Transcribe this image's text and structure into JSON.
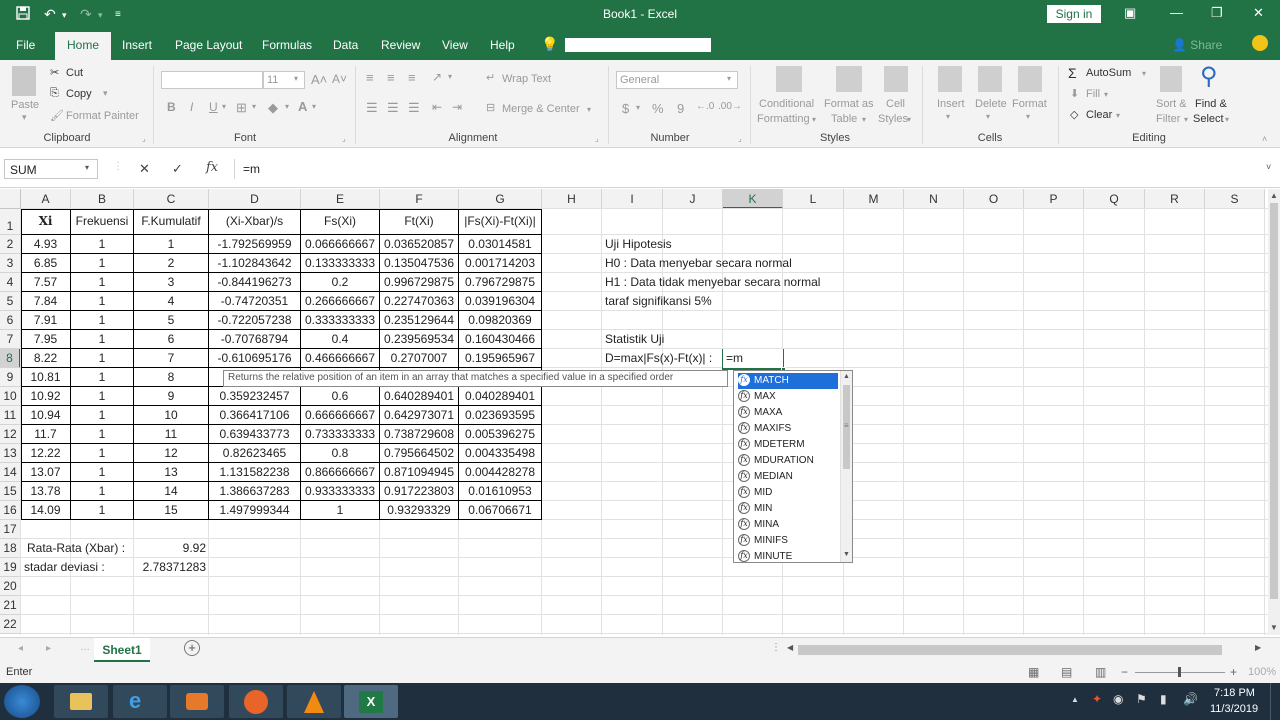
{
  "window": {
    "title": "Book1  -  Excel",
    "sign_in": "Sign in"
  },
  "ribbon_tabs": [
    "File",
    "Home",
    "Insert",
    "Page Layout",
    "Formulas",
    "Data",
    "Review",
    "View",
    "Help"
  ],
  "share_label": "Share",
  "ribbon": {
    "clipboard": {
      "paste": "Paste",
      "cut": "Cut",
      "copy": "Copy",
      "format_painter": "Format Painter",
      "group": "Clipboard"
    },
    "font": {
      "size": "11",
      "bold": "B",
      "italic": "I",
      "underline": "U",
      "group": "Font"
    },
    "alignment": {
      "wrap": "Wrap Text",
      "merge": "Merge & Center",
      "group": "Alignment"
    },
    "number": {
      "format": "General",
      "currency": "$",
      "percent": "%",
      "comma": "9",
      "group": "Number"
    },
    "styles": {
      "conditional": "Conditional",
      "conditional2": "Formatting",
      "format_as": "Format as",
      "format_as2": "Table",
      "cell": "Cell",
      "cell2": "Styles",
      "group": "Styles"
    },
    "cells": {
      "insert": "Insert",
      "delete": "Delete",
      "format": "Format",
      "group": "Cells"
    },
    "editing": {
      "autosum": "AutoSum",
      "fill": "Fill",
      "clear": "Clear",
      "sort": "Sort &",
      "sort2": "Filter",
      "find": "Find &",
      "find2": "Select",
      "group": "Editing"
    }
  },
  "formula_bar": {
    "name_box": "SUM",
    "cancel": "✕",
    "enter": "✓",
    "fx": "fx",
    "formula": "=m"
  },
  "columns": [
    "A",
    "B",
    "C",
    "D",
    "E",
    "F",
    "G",
    "H",
    "I",
    "J",
    "K",
    "L",
    "M",
    "N",
    "O",
    "P",
    "Q",
    "R",
    "S"
  ],
  "rows": [
    "1",
    "2",
    "3",
    "4",
    "5",
    "6",
    "7",
    "8",
    "9",
    "10",
    "11",
    "12",
    "13",
    "14",
    "15",
    "16",
    "17",
    "18",
    "19",
    "20",
    "21",
    "22"
  ],
  "table": {
    "headers": [
      "Xi",
      "Frekuensi",
      "F.Kumulatif",
      "(Xi-Xbar)/s",
      "Fs(Xi)",
      "Ft(Xi)",
      "|Fs(Xi)-Ft(Xi)|"
    ],
    "rows": [
      [
        "4.93",
        "1",
        "1",
        "-1.792569959",
        "0.066666667",
        "0.036520857",
        "0.03014581"
      ],
      [
        "6.85",
        "1",
        "2",
        "-1.102843642",
        "0.133333333",
        "0.135047536",
        "0.001714203"
      ],
      [
        "7.57",
        "1",
        "3",
        "-0.844196273",
        "0.2",
        "0.996729875",
        "0.796729875"
      ],
      [
        "7.84",
        "1",
        "4",
        "-0.74720351",
        "0.266666667",
        "0.227470363",
        "0.039196304"
      ],
      [
        "7.91",
        "1",
        "5",
        "-0.722057238",
        "0.333333333",
        "0.235129644",
        "0.09820369"
      ],
      [
        "7.95",
        "1",
        "6",
        "-0.70768794",
        "0.4",
        "0.239569534",
        "0.160430466"
      ],
      [
        "8.22",
        "1",
        "7",
        "-0.610695176",
        "0.466666667",
        "0.2707007",
        "0.195965967"
      ],
      [
        "10.81",
        "1",
        "8",
        "",
        "",
        "",
        ""
      ],
      [
        "10.92",
        "1",
        "9",
        "0.359232457",
        "0.6",
        "0.640289401",
        "0.040289401"
      ],
      [
        "10.94",
        "1",
        "10",
        "0.366417106",
        "0.666666667",
        "0.642973071",
        "0.023693595"
      ],
      [
        "11.7",
        "1",
        "11",
        "0.639433773",
        "0.733333333",
        "0.738729608",
        "0.005396275"
      ],
      [
        "12.22",
        "1",
        "12",
        "0.82623465",
        "0.8",
        "0.795664502",
        "0.004335498"
      ],
      [
        "13.07",
        "1",
        "13",
        "1.131582238",
        "0.866666667",
        "0.871094945",
        "0.004428278"
      ],
      [
        "13.78",
        "1",
        "14",
        "1.386637283",
        "0.933333333",
        "0.917223803",
        "0.01610953"
      ],
      [
        "14.09",
        "1",
        "15",
        "1.497999344",
        "1",
        "0.93293329",
        "0.06706671"
      ]
    ]
  },
  "summary": {
    "mean_label": "Rata-Rata (Xbar) :",
    "mean_value": "9.92",
    "sd_label": "stadar deviasi :",
    "sd_value": "2.78371283"
  },
  "hypothesis": {
    "title": "Uji Hipotesis",
    "h0": "H0 : Data menyebar secara normal",
    "h1": "H1 : Data tidak menyebar secara normal",
    "alpha": "taraf signifikansi 5%",
    "stat_title": "Statistik Uji",
    "d_label": "D=max|Fs(x)-Ft(x)| :",
    "active_cell_value": "=m"
  },
  "tooltip": "Returns the relative position of an item in an array that matches a specified value in a specified order",
  "autocomplete": [
    "MATCH",
    "MAX",
    "MAXA",
    "MAXIFS",
    "MDETERM",
    "MDURATION",
    "MEDIAN",
    "MID",
    "MIN",
    "MINA",
    "MINIFS",
    "MINUTE"
  ],
  "sheet_tab": "Sheet1",
  "status": "Enter",
  "zoom": "100%",
  "clock": {
    "time": "7:18 PM",
    "date": "11/3/2019"
  },
  "colors": {
    "excel_green": "#217346",
    "selection_blue": "#1e6fd9"
  }
}
